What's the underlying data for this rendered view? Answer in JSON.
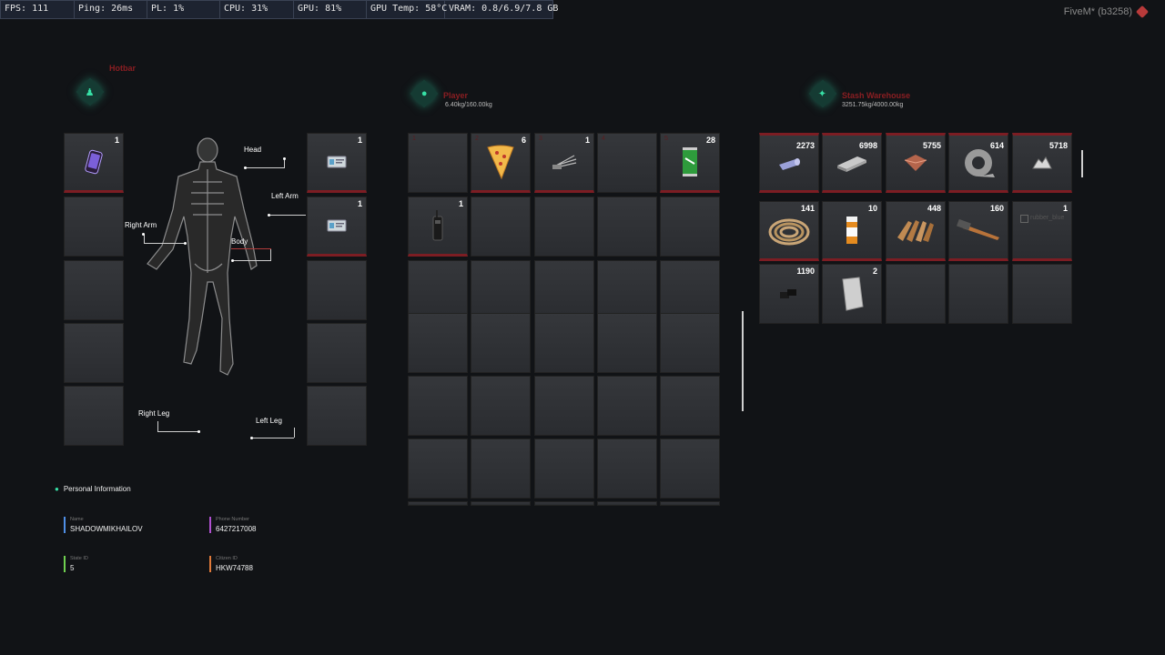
{
  "perf": {
    "fps": "FPS: 111",
    "ping": "Ping: 26ms",
    "pl": "PL: 1%",
    "cpu": "CPU: 31%",
    "gpu": "GPU: 81%",
    "gputemp": "GPU Temp: 58°C",
    "vram": "VRAM: 0.8/6.9/7.8 GB"
  },
  "watermark": "FiveM* (b3258)",
  "equip": {
    "title": "Hotbar",
    "left_counts": [
      "1",
      "",
      "",
      "",
      ""
    ],
    "right_counts": [
      "1",
      "1",
      "",
      "",
      ""
    ],
    "labels": {
      "head": "Head",
      "left_arm": "Left Arm",
      "right_arm": "Right Arm",
      "body": "Body",
      "right_leg": "Right Leg",
      "left_leg": "Left Leg"
    }
  },
  "player": {
    "title": "Player",
    "weight": "6.40kg/160.00kg",
    "row1_counts": [
      "",
      "6",
      "1",
      "",
      "28"
    ],
    "row2_counts": [
      "1",
      "",
      "",
      "",
      ""
    ]
  },
  "ground": {
    "title": "Stash Warehouse",
    "weight": "3251.75kg/4000.00kg",
    "counts": [
      [
        "2273",
        "6998",
        "5755",
        "614",
        "5718"
      ],
      [
        "141",
        "10",
        "448",
        "160",
        "1"
      ],
      [
        "1190",
        "2",
        "",
        "",
        ""
      ]
    ],
    "broken_image_alt": "rubber_blue"
  },
  "personal": {
    "title": "Personal Information",
    "name_label": "Name",
    "name": "SHADOWMIKHAILOV",
    "phone_label": "Phone Number",
    "phone": "6427217008",
    "state_label": "State ID",
    "state": "5",
    "citizen_label": "Citizen ID",
    "citizen": "HKW74788"
  },
  "colors": {
    "accent": "#37e0a6",
    "slot_border": "#7c1d23",
    "name": "#4f8fe6",
    "phone": "#b050d0",
    "state": "#70d050",
    "citizen": "#e07a3a"
  }
}
